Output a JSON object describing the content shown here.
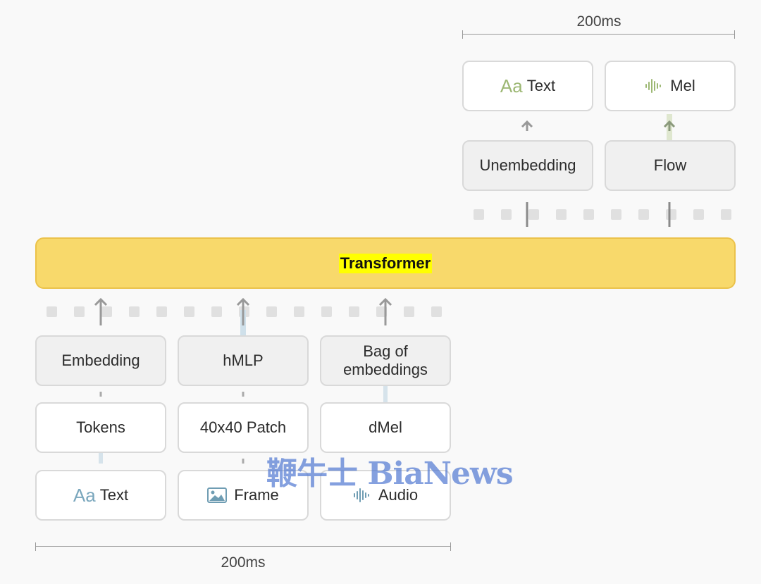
{
  "top": {
    "duration_label": "200ms",
    "outputs": [
      {
        "icon": "text-aa-icon",
        "aa": "Aa",
        "label": "Text"
      },
      {
        "icon": "waveform-icon",
        "label": "Mel"
      }
    ],
    "heads": [
      {
        "label": "Unembedding"
      },
      {
        "label": "Flow"
      }
    ]
  },
  "transformer": {
    "label": "Transformer"
  },
  "bottom": {
    "duration_label": "200ms",
    "encoders": [
      {
        "label": "Embedding"
      },
      {
        "label": "hMLP"
      },
      {
        "label_line1": "Bag of",
        "label_line2": "embeddings"
      }
    ],
    "representations": [
      {
        "label": "Tokens"
      },
      {
        "label": "40x40 Patch"
      },
      {
        "label": "dMel"
      }
    ],
    "inputs": [
      {
        "icon": "text-aa-icon",
        "aa": "Aa",
        "label": "Text"
      },
      {
        "icon": "image-icon",
        "label": "Frame"
      },
      {
        "icon": "waveform-icon",
        "label": "Audio"
      }
    ]
  },
  "watermark": {
    "text": "鞭牛士 BiaNews"
  },
  "colors": {
    "transformer_fill": "#f8d96b",
    "transformer_highlight": "#ffff00",
    "text_blue": "#7aa7bd",
    "mel_green": "#9db874",
    "token_square": "#e0e0e0"
  }
}
